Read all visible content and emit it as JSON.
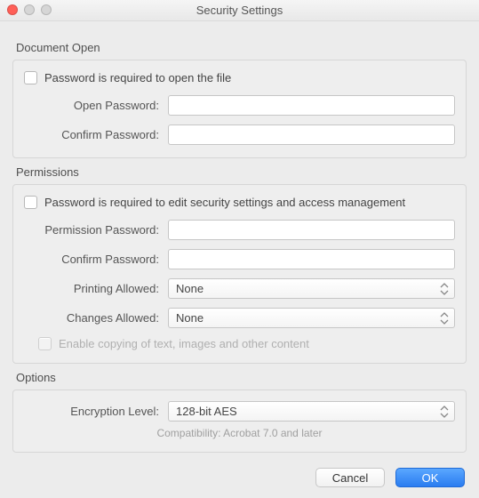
{
  "title": "Security Settings",
  "sections": {
    "document_open": {
      "label": "Document Open",
      "check_label": "Password is required to open the file",
      "open_password_label": "Open Password:",
      "confirm_password_label": "Confirm Password:",
      "open_password_value": "",
      "confirm_password_value": ""
    },
    "permissions": {
      "label": "Permissions",
      "check_label": "Password is required to edit security settings and access management",
      "permission_password_label": "Permission Password:",
      "confirm_password_label": "Confirm Password:",
      "permission_password_value": "",
      "confirm_password_value": "",
      "printing_label": "Printing Allowed:",
      "printing_value": "None",
      "changes_label": "Changes Allowed:",
      "changes_value": "None",
      "enable_copy_label": "Enable copying of text, images and other content"
    },
    "options": {
      "label": "Options",
      "encryption_label": "Encryption Level:",
      "encryption_value": "128-bit AES",
      "compat_text": "Compatibility: Acrobat 7.0 and later"
    }
  },
  "buttons": {
    "cancel": "Cancel",
    "ok": "OK"
  }
}
